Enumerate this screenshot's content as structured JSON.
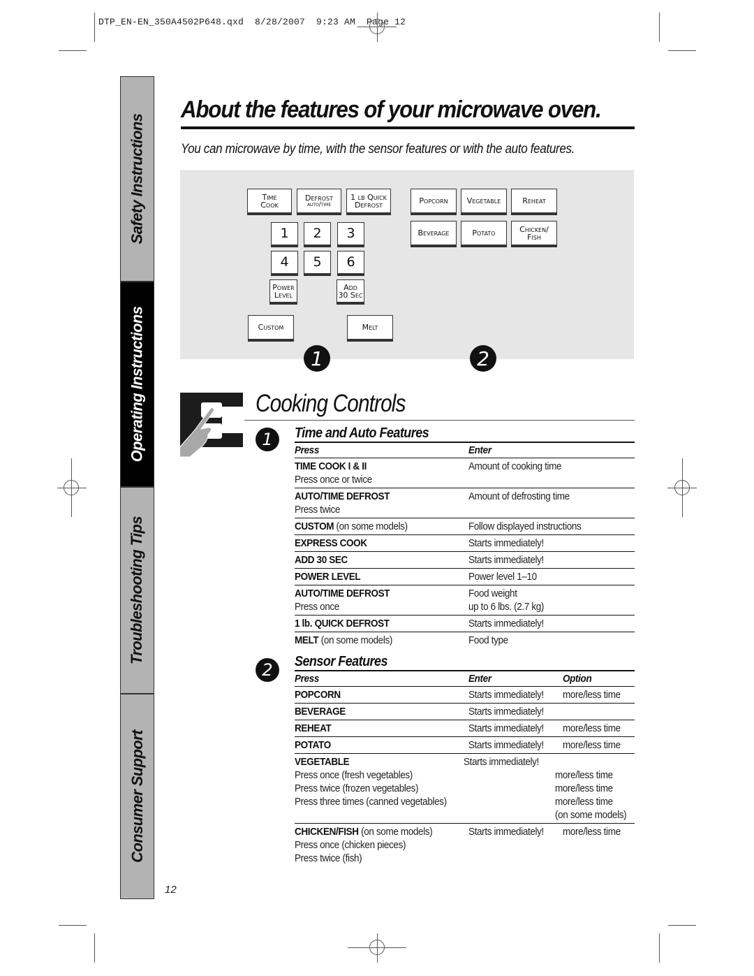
{
  "print_slug": "DTP_EN-EN_350A4502P648.qxd  8/28/2007  9:23 AM  Page 12",
  "side_tabs": [
    {
      "label": "Safety Instructions",
      "active": false
    },
    {
      "label": "Operating Instructions",
      "active": true
    },
    {
      "label": "Troubleshooting Tips",
      "active": false
    },
    {
      "label": "Consumer Support",
      "active": false
    }
  ],
  "page_number": "12",
  "header": {
    "title": "About the features of your microwave oven.",
    "subtitle": "You can microwave by time, with the sensor features or with the auto features."
  },
  "control_panel": {
    "keys_left_top": [
      {
        "line1": "Time",
        "line2": "Cook"
      },
      {
        "line1": "Defrost",
        "line2": "auto/time"
      },
      {
        "line1": "1 lb Quick",
        "line2": "Defrost"
      }
    ],
    "number_keys": [
      "1",
      "2",
      "3",
      "4",
      "5",
      "6"
    ],
    "power_level": {
      "line1": "Power",
      "line2": "Level"
    },
    "add_30": {
      "line1": "Add",
      "line2": "30 Sec"
    },
    "custom": "Custom",
    "melt": "Melt",
    "sensor_keys": [
      {
        "line1": "Popcorn",
        "line2": ""
      },
      {
        "line1": "Vegetable",
        "line2": ""
      },
      {
        "line1": "Reheat",
        "line2": ""
      },
      {
        "line1": "Beverage",
        "line2": ""
      },
      {
        "line1": "Potato",
        "line2": ""
      },
      {
        "line1": "Chicken/",
        "line2": "Fish"
      }
    ],
    "badges": [
      "1",
      "2"
    ]
  },
  "cooking_controls": {
    "title": "Cooking Controls",
    "time_auto": {
      "badge": "1",
      "title": "Time and Auto Features",
      "headers": {
        "press": "Press",
        "enter": "Enter"
      },
      "rows": [
        {
          "press": "TIME COOK I & II",
          "note": "",
          "sub": [
            "Press once or twice"
          ],
          "enter": [
            "Amount of cooking time"
          ]
        },
        {
          "press": "AUTO/TIME DEFROST",
          "note": "",
          "sub": [
            "Press twice"
          ],
          "enter": [
            "Amount of defrosting time"
          ]
        },
        {
          "press": "CUSTOM",
          "note": "(on some models)",
          "sub": [],
          "enter": [
            "Follow displayed instructions"
          ]
        },
        {
          "press": "EXPRESS COOK",
          "note": "",
          "sub": [],
          "enter": [
            "Starts immediately!"
          ]
        },
        {
          "press": "ADD 30 SEC",
          "note": "",
          "sub": [],
          "enter": [
            "Starts immediately!"
          ]
        },
        {
          "press": "POWER LEVEL",
          "note": "",
          "sub": [],
          "enter": [
            "Power level 1–10"
          ]
        },
        {
          "press": "AUTO/TIME DEFROST",
          "note": "",
          "sub": [
            "Press once"
          ],
          "enter": [
            "Food weight",
            "up to 6 lbs. (2.7 kg)"
          ]
        },
        {
          "press": "1 lb. QUICK DEFROST",
          "note": "",
          "sub": [],
          "enter": [
            "Starts immediately!"
          ]
        },
        {
          "press": "MELT",
          "note": "(on some models)",
          "sub": [],
          "enter": [
            "Food type"
          ]
        }
      ]
    },
    "sensor": {
      "badge": "2",
      "title": "Sensor Features",
      "headers": {
        "press": "Press",
        "enter": "Enter",
        "option": "Option"
      },
      "rows": [
        {
          "press": "POPCORN",
          "note": "",
          "sub": [],
          "enter": [
            "Starts immediately!"
          ],
          "option": [
            "more/less time"
          ]
        },
        {
          "press": "BEVERAGE",
          "note": "",
          "sub": [],
          "enter": [
            "Starts immediately!"
          ],
          "option": []
        },
        {
          "press": "REHEAT",
          "note": "",
          "sub": [],
          "enter": [
            "Starts immediately!"
          ],
          "option": [
            "more/less time"
          ]
        },
        {
          "press": "POTATO",
          "note": "",
          "sub": [],
          "enter": [
            "Starts immediately!"
          ],
          "option": [
            "more/less time"
          ]
        },
        {
          "press": "VEGETABLE",
          "note": "",
          "sub": [
            "Press once (fresh vegetables)",
            "Press twice (frozen vegetables)",
            "Press three times (canned vegetables)"
          ],
          "enter": [
            "Starts immediately!"
          ],
          "option": [
            "",
            "more/less time",
            "more/less time",
            "more/less time",
            "(on some models)"
          ]
        },
        {
          "press": "CHICKEN/FISH",
          "note": "(on some models)",
          "sub": [
            "Press once (chicken pieces)",
            "Press twice (fish)"
          ],
          "enter": [
            "Starts immediately!"
          ],
          "option": [
            "more/less time"
          ]
        }
      ]
    }
  }
}
